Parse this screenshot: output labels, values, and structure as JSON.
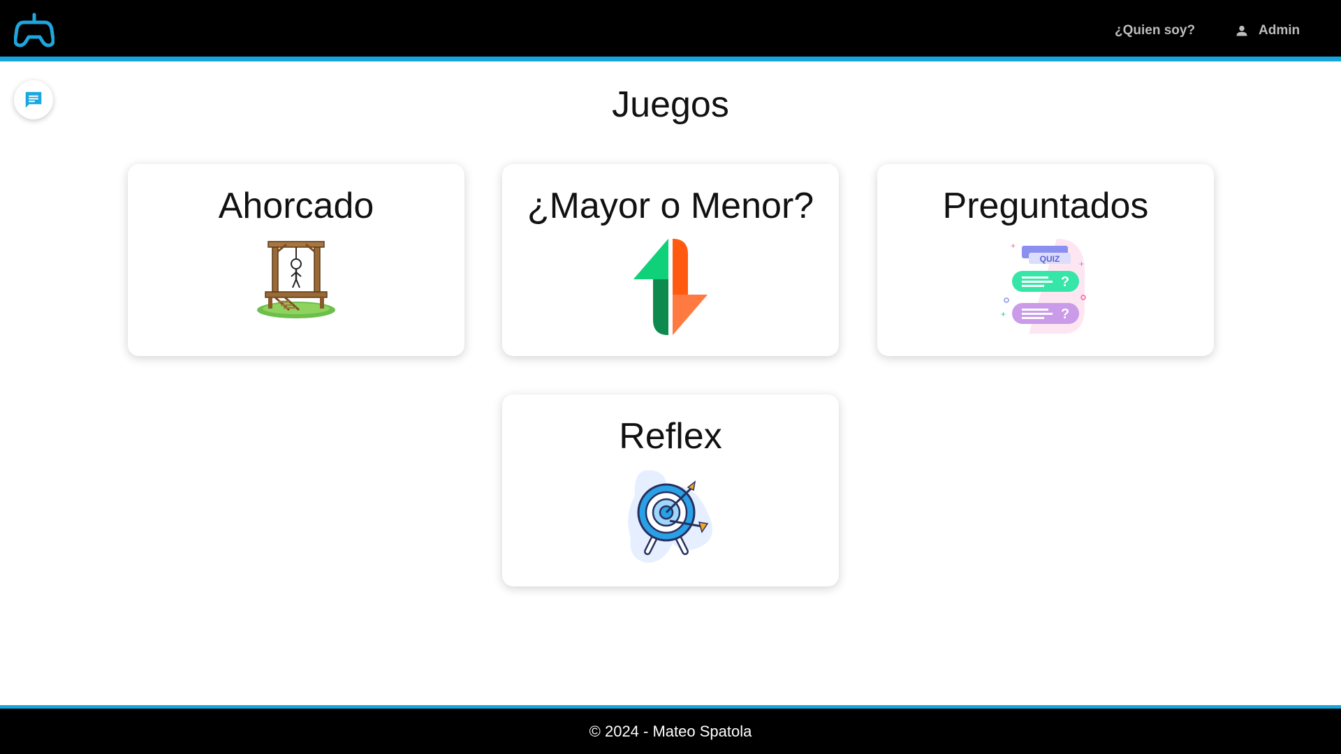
{
  "header": {
    "logo_icon": "gamepad-icon",
    "nav": {
      "whoami_label": "¿Quien soy?",
      "admin_label": "Admin",
      "admin_icon": "person-icon"
    }
  },
  "chat": {
    "icon": "chat-icon"
  },
  "main": {
    "title": "Juegos",
    "games": [
      {
        "title": "Ahorcado",
        "icon": "gallows-icon"
      },
      {
        "title": "¿Mayor o Menor?",
        "icon": "up-down-arrows-icon"
      },
      {
        "title": "Preguntados",
        "icon": "quiz-icon"
      },
      {
        "title": "Reflex",
        "icon": "target-arrow-icon"
      }
    ]
  },
  "footer": {
    "text": "© 2024 - Mateo Spatola"
  },
  "colors": {
    "accent": "#16a6dc",
    "header_bg": "#000000",
    "footer_bg": "#000000",
    "nav_text": "#bdbdbd"
  }
}
